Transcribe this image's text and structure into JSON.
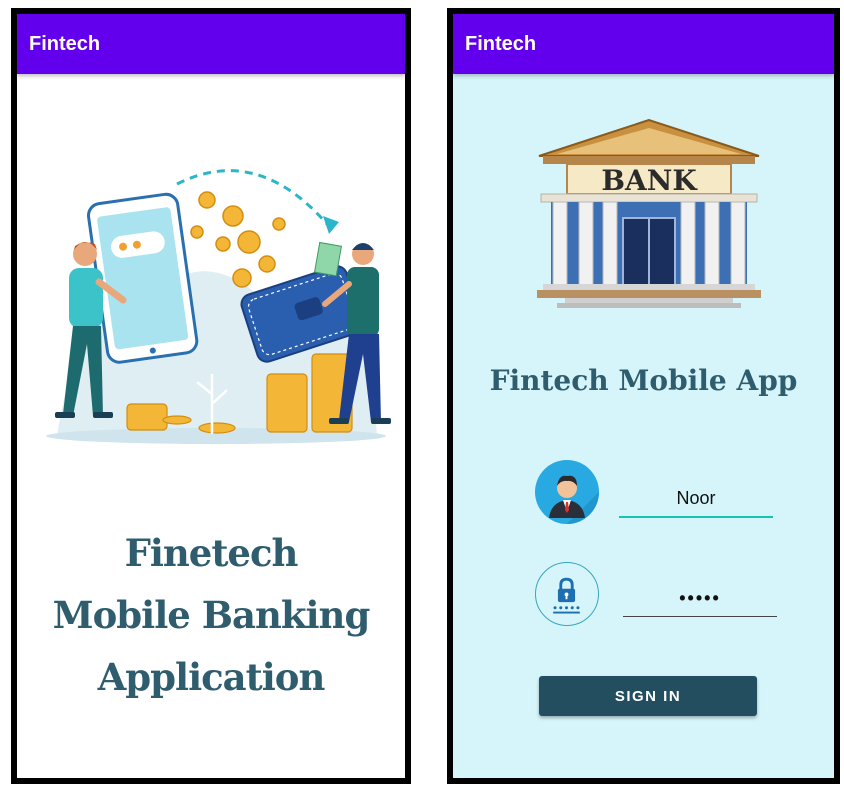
{
  "left_screen": {
    "appbar_title": "Fintech",
    "splash_lines": [
      "Finetech",
      "Mobile Banking",
      "Application"
    ]
  },
  "right_screen": {
    "appbar_title": "Fintech",
    "bank_sign": "BANK",
    "app_title": "Fintech Mobile App",
    "username_value": "Noor",
    "password_value": "•••••",
    "signin_label": "SIGN IN"
  },
  "colors": {
    "appbar": "#6200ee",
    "heading_text": "#2f5d6e",
    "signin_button": "#224e5f",
    "login_background": "#d5f5fb",
    "active_underline": "#15c4b3"
  },
  "icons": [
    "person-avatar-icon",
    "lock-icon",
    "bank-building-icon",
    "mobile-banking-illustration"
  ]
}
